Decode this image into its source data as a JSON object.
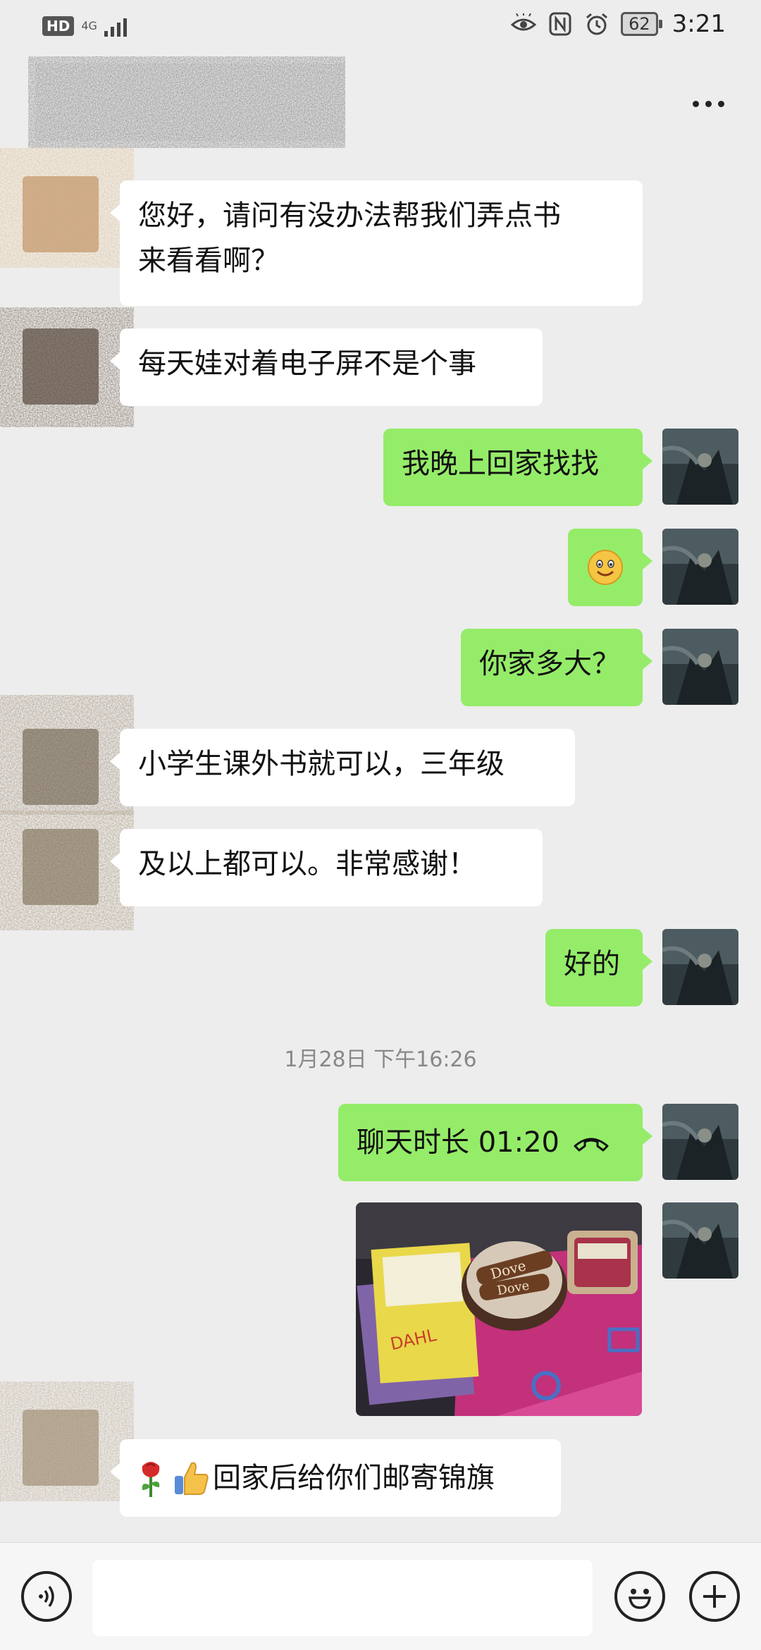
{
  "status_bar": {
    "hd": "HD",
    "network": "4G",
    "battery": "62",
    "time": "3:21"
  },
  "messages": [
    {
      "side": "left",
      "text_lines": [
        "您好，请问有没办法帮我们弄点书",
        "来看看啊？"
      ]
    },
    {
      "side": "left",
      "text": "每天娃对着电子屏不是个事"
    },
    {
      "side": "right",
      "text": "我晚上回家找找"
    },
    {
      "side": "right",
      "emoji": "smiley-emoji"
    },
    {
      "side": "right",
      "text": "你家多大？"
    },
    {
      "side": "left",
      "text": "小学生课外书就可以，三年级"
    },
    {
      "side": "left",
      "text": "及以上都可以。非常感谢！"
    },
    {
      "side": "right",
      "text": "好的"
    },
    {
      "side": "system",
      "text": "1月28日 下午16:26"
    },
    {
      "side": "right",
      "text": "聊天时长 01:20",
      "icon": "phone-hangup-icon"
    },
    {
      "side": "right",
      "image": "photo of books and Dove chocolates on a pink bag"
    },
    {
      "side": "left",
      "emojis": [
        "rose-emoji",
        "thumbs-up-emoji"
      ],
      "text": "回家后给你们邮寄锦旗"
    }
  ],
  "input_bar": {
    "voice_icon": "voice-icon",
    "emoji_icon": "emoji-icon",
    "plus_icon": "plus-icon",
    "value": ""
  },
  "colors": {
    "background": "#ededed",
    "right_bubble": "#95ec69",
    "left_bubble": "#ffffff",
    "input_bar": "#f6f6f6"
  }
}
